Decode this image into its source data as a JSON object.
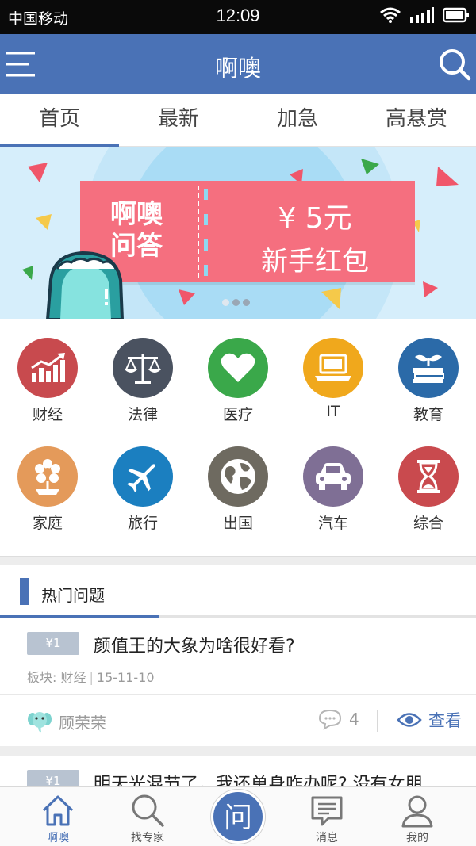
{
  "status_bar": {
    "carrier": "中国移动",
    "time": "12:09"
  },
  "nav": {
    "title": "啊噢"
  },
  "tabs": [
    {
      "label": "首页",
      "active": true
    },
    {
      "label": "最新",
      "active": false
    },
    {
      "label": "加急",
      "active": false
    },
    {
      "label": "高悬赏",
      "active": false
    }
  ],
  "banner": {
    "left_line1": "啊噢",
    "left_line2": "问答",
    "amount": "¥ 5元",
    "subtitle": "新手红包",
    "page_count": 3,
    "current_page": 1
  },
  "categories": [
    {
      "label": "财经",
      "icon": "growth-chart-icon",
      "color": "#c84a4e"
    },
    {
      "label": "法律",
      "icon": "scales-icon",
      "color": "#4a5260"
    },
    {
      "label": "医疗",
      "icon": "heart-icon",
      "color": "#3aa84a"
    },
    {
      "label": "IT",
      "icon": "laptop-icon",
      "color": "#f0a81c"
    },
    {
      "label": "教育",
      "icon": "book-sprout-icon",
      "color": "#2b6aa8"
    },
    {
      "label": "家庭",
      "icon": "flower-icon",
      "color": "#e49a5a"
    },
    {
      "label": "旅行",
      "icon": "airplane-icon",
      "color": "#1b7fc0"
    },
    {
      "label": "出国",
      "icon": "globe-icon",
      "color": "#6e6a60"
    },
    {
      "label": "汽车",
      "icon": "car-icon",
      "color": "#7f6f95"
    },
    {
      "label": "综合",
      "icon": "hourglass-icon",
      "color": "#c94a4e"
    }
  ],
  "hot": {
    "title": "热门问题"
  },
  "questions": [
    {
      "reward": "¥1",
      "title": "颜值王的大象为啥很好看?",
      "board_label": "板块:",
      "board": "财经",
      "date": "15-11-10",
      "user": "顾荣荣",
      "comments": "4",
      "view_label": "查看"
    },
    {
      "reward": "¥1",
      "title": "明天光混节了，我还单身咋办呢? 没有女朋"
    }
  ],
  "tabbar": [
    {
      "label": "啊噢",
      "icon": "home-icon",
      "active": true
    },
    {
      "label": "找专家",
      "icon": "search-icon",
      "active": false
    },
    {
      "label": "问",
      "icon": "ask-icon",
      "active": false
    },
    {
      "label": "消息",
      "icon": "message-icon",
      "active": false
    },
    {
      "label": "我的",
      "icon": "user-icon",
      "active": false
    }
  ],
  "colors": {
    "primary": "#4a72b6",
    "banner_ticket": "#f56f7f",
    "badge": "#b8c3d1"
  }
}
